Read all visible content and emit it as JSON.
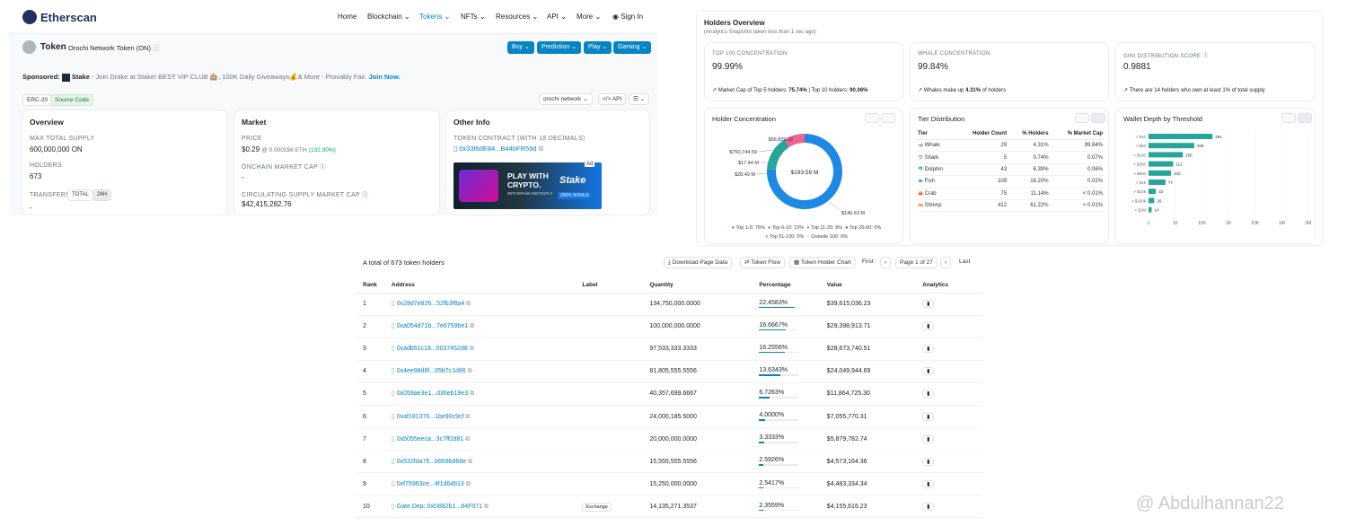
{
  "header": {
    "logo": "Etherscan",
    "nav": [
      "Home",
      "Blockchain",
      "Tokens",
      "NFTs",
      "Resources",
      "API",
      "More",
      "Sign In"
    ]
  },
  "token": {
    "title": "Token",
    "name": "Orochi Network Token (ON)",
    "buttons": [
      "Buy",
      "Prediction",
      "Play",
      "Gaming"
    ]
  },
  "sponsored": {
    "label": "Sponsored:",
    "brand": "Stake",
    "text": " - Join Drake at Stake! BEST VIP CLUB 🎰, 100K Daily Giveaways💰& More - Provably Fair.",
    "cta": "Join Now."
  },
  "tags": {
    "erc": "ERC-20",
    "source": "Source Code",
    "network": "orochi network",
    "more": "</> API"
  },
  "overview": {
    "title": "Overview",
    "max_label": "MAX TOTAL SUPPLY",
    "max_value": "600,000,000 ON",
    "holders_label": "HOLDERS",
    "holders_value": "673",
    "transfers_label": "TRANSFERS",
    "total": "TOTAL",
    "h24": "24H",
    "transfers_value": "-"
  },
  "market": {
    "title": "Market",
    "price_label": "PRICE",
    "price": "$0.29",
    "price_eth": "@ 0.000156 ETH",
    "price_change": "(132.30%)",
    "onchain_label": "ONCHAIN MARKET CAP",
    "onchain_value": "-",
    "circ_label": "CIRCULATING SUPPLY MARKET CAP",
    "circ_value": "$42,415,282.76"
  },
  "other": {
    "title": "Other Info",
    "contract_label": "TOKEN CONTRACT (WITH 18 DECIMALS)",
    "contract": "0x33f6dE84...B44bFR59d",
    "ad_badge": "Ad",
    "ad_line1": "PLAY WITH",
    "ad_line2": "CRYPTO.",
    "ad_line3": "WITHDRAW INSTANTLY",
    "ad_brand": "Stake",
    "ad_bonus": "200% BONUS"
  },
  "holders_overview": {
    "title": "Holders Overview",
    "subtitle": "(Analytics Snapshot taken less than 1 sec ago)",
    "top100_label": "TOP 100 CONCENTRATION",
    "top100_value": "99.99%",
    "top100_note_a": "Market Cap of Top 5 holders:",
    "top100_note_b": "75.74%",
    "top100_note_c": "| Top 10 holders:",
    "top100_note_d": "90.06%",
    "whale_label": "WHALE CONCENTRATION",
    "whale_value": "99.84%",
    "whale_note_a": "Whales make up",
    "whale_note_b": "4.31%",
    "whale_note_c": "of holders",
    "gini_label": "GINI DISTRIBUTION SCORE",
    "gini_value": "0.9881",
    "gini_note": "There are 14 holders who own at least 1% of total supply"
  },
  "concentration": {
    "title": "Holder Concentration",
    "center": "$193.59 M",
    "labels": [
      "$56,829.12",
      "$750,744.59",
      "$17.44 M",
      "$28.49 M",
      "$146.63 M"
    ],
    "legend": [
      "Top 1-5: 76%",
      "Top 6-10: 15%",
      "Top 11-25: 9%",
      "Top 26-50: 0%",
      "Top 51-100: 0%",
      "Outside 100: 0%"
    ]
  },
  "chart_data": {
    "type": "pie",
    "title": "Holder Concentration",
    "categories": [
      "Top 1-5",
      "Top 6-10",
      "Top 11-25",
      "Top 26-50",
      "Top 51-100",
      "Outside 100"
    ],
    "values": [
      76,
      15,
      9,
      0,
      0,
      0
    ],
    "colors": [
      "#1e88e5",
      "#26a69a",
      "#f06292",
      "#8e24aa",
      "#9e9e9e",
      "#e0e0e0"
    ]
  },
  "tier": {
    "title": "Tier Distribution",
    "headers": [
      "Tier",
      "Holder Count",
      "% Holders",
      "% Market Cap"
    ],
    "rows": [
      [
        "Whale",
        "29",
        "4.31%",
        "99.84%"
      ],
      [
        "Shark",
        "5",
        "0.74%",
        "0.07%"
      ],
      [
        "Dolphin",
        "43",
        "6.39%",
        "0.06%"
      ],
      [
        "Fish",
        "109",
        "16.20%",
        "0.02%"
      ],
      [
        "Crab",
        "75",
        "11.14%",
        "< 0.01%"
      ],
      [
        "Shrimp",
        "412",
        "61.22%",
        "< 0.01%"
      ]
    ]
  },
  "wallet_depth": {
    "title": "Wallet Depth by Threshold",
    "categories": [
      "> $10",
      "> $50",
      "> $100",
      "> $250",
      "> $500",
      "> $1k",
      "> $10k",
      "> $100k",
      "> $1M"
    ],
    "values": [
      291,
      208,
      156,
      112,
      102,
      77,
      33,
      26,
      14
    ],
    "xticks": [
      "1",
      "10",
      "100",
      "1K",
      "10K",
      "1M",
      "2M"
    ]
  },
  "holders_table": {
    "summary": "A total of 673 token holders",
    "download": "Download Page Data",
    "flow": "Token Flow",
    "chart": "Token Holder Chart",
    "first": "First",
    "page": "Page 1 of 27",
    "last": "Last",
    "headers": [
      "Rank",
      "Address",
      "Label",
      "Quantity",
      "Percentage",
      "Value",
      "Analytics"
    ],
    "rows": [
      {
        "rank": "1",
        "address": "0x28d7e826...52fb3f8a4",
        "label": "",
        "quantity": "134,750,000.0000",
        "pct": "22.4583%",
        "pct_value": 22.4583,
        "value": "$39,615,036.23"
      },
      {
        "rank": "2",
        "address": "0xa054d71b...7e6759be1",
        "label": "",
        "quantity": "100,000,000.0000",
        "pct": "16.6667%",
        "pct_value": 16.6667,
        "value": "$29,398,913.71"
      },
      {
        "rank": "3",
        "address": "0xadb51c18...0037452d8",
        "label": "",
        "quantity": "97,533,333.3333",
        "pct": "16.2556%",
        "pct_value": 16.2556,
        "value": "$28,673,740.51"
      },
      {
        "rank": "4",
        "address": "0x4ee98d8f...05b7c1d86",
        "label": "",
        "quantity": "81,805,555.5556",
        "pct": "13.6343%",
        "pct_value": 13.6343,
        "value": "$24,049,944.69"
      },
      {
        "rank": "5",
        "address": "0x059ae3e1...d36eb19e3",
        "label": "",
        "quantity": "40,357,699.6667",
        "pct": "6.7263%",
        "pct_value": 6.7263,
        "value": "$11,864,725.30"
      },
      {
        "rank": "6",
        "address": "0xaf181376...1be90c9cf",
        "label": "",
        "quantity": "24,000,185.5000",
        "pct": "4.0000%",
        "pct_value": 4.0,
        "value": "$7,055,770.31"
      },
      {
        "rank": "7",
        "address": "0xb055eeca...3c7ff2d81",
        "label": "",
        "quantity": "20,000,000.0000",
        "pct": "3.3333%",
        "pct_value": 3.3333,
        "value": "$5,879,782.74"
      },
      {
        "rank": "8",
        "address": "0x532fda76...b669b988e",
        "label": "",
        "quantity": "15,555,555.5556",
        "pct": "2.5926%",
        "pct_value": 2.5926,
        "value": "$4,573,164.36"
      },
      {
        "rank": "9",
        "address": "0xf75963ce...4f1d64b13",
        "label": "",
        "quantity": "15,250,000.0000",
        "pct": "2.5417%",
        "pct_value": 2.5417,
        "value": "$4,483,334.34"
      },
      {
        "rank": "10",
        "address": "Gate Dep: 0xD882b1...84F071",
        "label": "Exchange",
        "quantity": "14,135,271.3537",
        "pct": "2.3559%",
        "pct_value": 2.3559,
        "value": "$4,155,616.23"
      }
    ]
  },
  "watermark": "@ Abdulhannan22"
}
